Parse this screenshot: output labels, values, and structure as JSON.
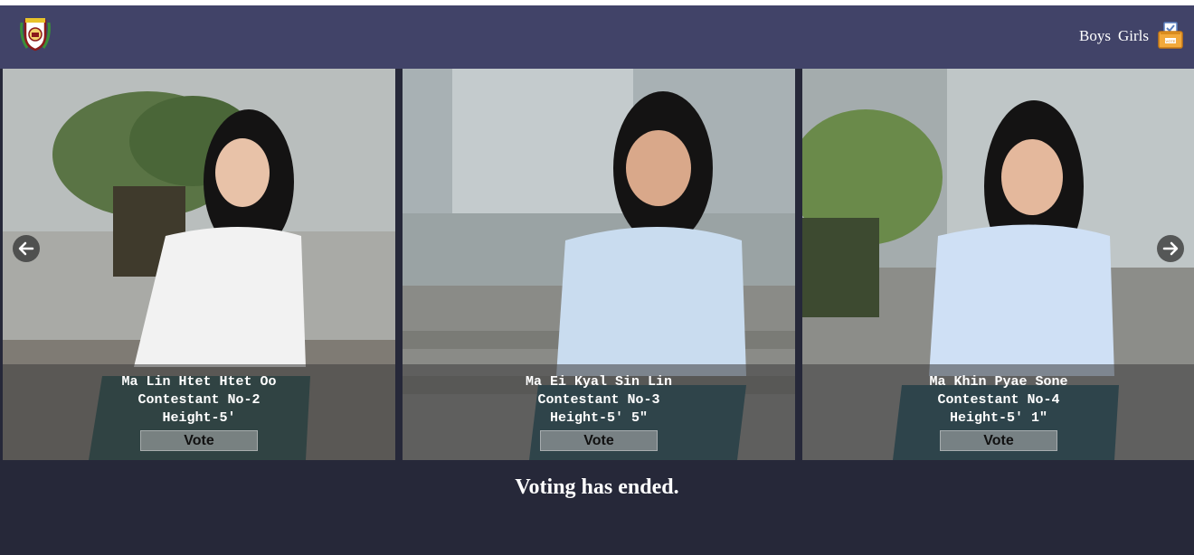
{
  "nav": {
    "links": [
      "Boys",
      "Girls"
    ],
    "logo_icon": "school-crest-icon",
    "ballot_icon": "ballot-box-icon",
    "ballot_label": "VOTE"
  },
  "contestants": [
    {
      "name": "Ma Lin Htet Htet Oo",
      "number": "Contestant No-2",
      "height": "Height-5'",
      "vote_label": "Vote"
    },
    {
      "name": "Ma Ei Kyal Sin Lin",
      "number": "Contestant No-3",
      "height": "Height-5' 5\"",
      "vote_label": "Vote"
    },
    {
      "name": "Ma Khin Pyae Sone",
      "number": "Contestant No-4",
      "height": "Height-5' 1\"",
      "vote_label": "Vote"
    }
  ],
  "carousel": {
    "prev_icon": "arrow-left-icon",
    "next_icon": "arrow-right-icon"
  },
  "status_message": "Voting has ended.",
  "colors": {
    "navbar": "#414368",
    "background": "#262839",
    "caption_overlay": "rgba(60,60,60,0.55)"
  }
}
